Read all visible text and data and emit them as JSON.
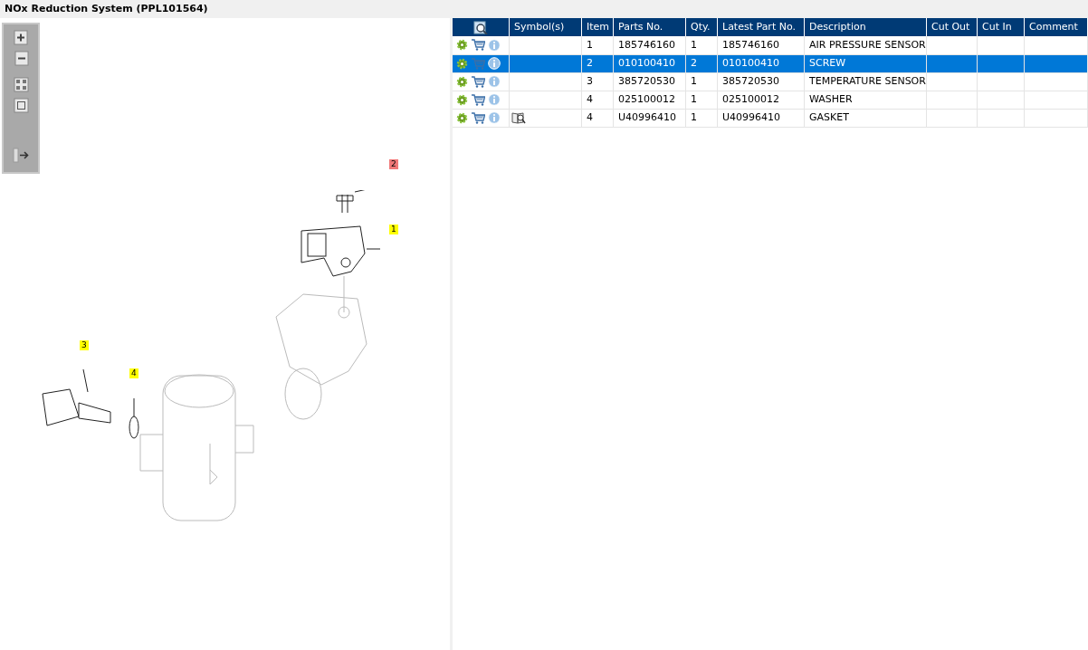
{
  "window": {
    "title": "NOx Reduction System (PPL101564)"
  },
  "diagram": {
    "callouts": [
      {
        "label": "2",
        "selected": true
      },
      {
        "label": "1",
        "selected": false
      },
      {
        "label": "3",
        "selected": false
      },
      {
        "label": "4",
        "selected": false
      }
    ]
  },
  "table": {
    "columns": [
      "Symbol(s)",
      "Item",
      "Parts No.",
      "Qty.",
      "Latest Part No.",
      "Description",
      "Cut Out",
      "Cut In",
      "Comment"
    ],
    "rows": [
      {
        "selected": false,
        "symbol": false,
        "item": "1",
        "parts_no": "185746160",
        "qty": "1",
        "latest_part_no": "185746160",
        "description": "AIR PRESSURE SENSOR"
      },
      {
        "selected": true,
        "symbol": false,
        "item": "2",
        "parts_no": "010100410",
        "qty": "2",
        "latest_part_no": "010100410",
        "description": "SCREW"
      },
      {
        "selected": false,
        "symbol": false,
        "item": "3",
        "parts_no": "385720530",
        "qty": "1",
        "latest_part_no": "385720530",
        "description": "TEMPERATURE SENSOR"
      },
      {
        "selected": false,
        "symbol": false,
        "item": "4",
        "parts_no": "025100012",
        "qty": "1",
        "latest_part_no": "025100012",
        "description": "WASHER"
      },
      {
        "selected": false,
        "symbol": true,
        "item": "4",
        "parts_no": "U40996410",
        "qty": "1",
        "latest_part_no": "U40996410",
        "description": "GASKET"
      }
    ]
  }
}
